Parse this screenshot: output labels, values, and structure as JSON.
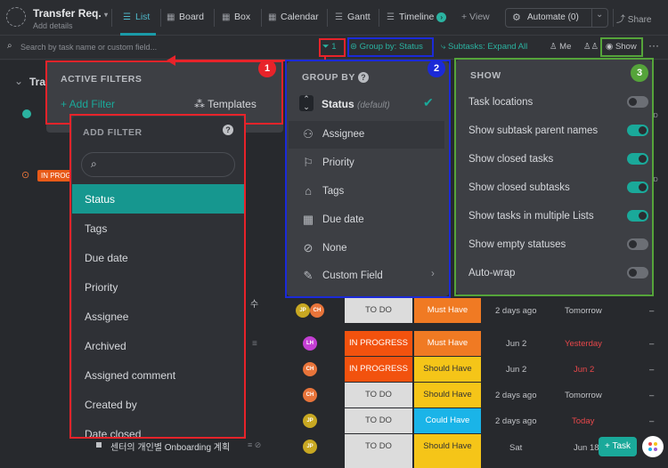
{
  "header": {
    "title": "Transfer Req.",
    "subtitle": "Add details",
    "title_caret": "▾"
  },
  "tabs": [
    {
      "label": "List",
      "icon": "☰"
    },
    {
      "label": "Board",
      "icon": "▦"
    },
    {
      "label": "Box",
      "icon": "▦"
    },
    {
      "label": "Calendar",
      "icon": "▦"
    },
    {
      "label": "Gantt",
      "icon": "☰"
    },
    {
      "label": "Timeline",
      "icon": "☰"
    },
    {
      "label": "+ View",
      "icon": ""
    }
  ],
  "automate": {
    "label": "Automate (0)",
    "caret": "⌄"
  },
  "share": {
    "label": "Share"
  },
  "toolbar": {
    "search_placeholder": "Search by task name or custom field...",
    "filter_count": "1",
    "group_by": "Group by: Status",
    "subtasks": "Subtasks: Expand All",
    "me": "Me",
    "show": "Show",
    "more": "···"
  },
  "markers": [
    "1",
    "2",
    "3"
  ],
  "active_filters": {
    "title": "ACTIVE FILTERS",
    "add_filter": "+ Add Filter",
    "templates": "Templates"
  },
  "add_filter": {
    "title": "ADD FILTER",
    "help": "?",
    "options": [
      "Status",
      "Tags",
      "Due date",
      "Priority",
      "Assignee",
      "Archived",
      "Assigned comment",
      "Created by",
      "Date closed"
    ]
  },
  "group_by": {
    "title": "GROUP BY",
    "help": "?",
    "status_label": "Status",
    "status_note": "(default)",
    "options": [
      "Assignee",
      "Priority",
      "Tags",
      "Due date",
      "None",
      "Custom Field"
    ]
  },
  "show": {
    "title": "SHOW",
    "options": [
      {
        "label": "Task locations",
        "on": false
      },
      {
        "label": "Show subtask parent names",
        "on": true
      },
      {
        "label": "Show closed tasks",
        "on": true
      },
      {
        "label": "Show closed subtasks",
        "on": true
      },
      {
        "label": "Show tasks in multiple Lists",
        "on": true
      },
      {
        "label": "Show empty statuses",
        "on": false
      },
      {
        "label": "Auto-wrap",
        "on": false
      }
    ]
  },
  "background": {
    "list_header": "Tra",
    "in_progress_tag": "IN PROG",
    "korean_char": "수",
    "korean_task": "센터의 개인별 Onboarding 계획",
    "ed_label": "ED",
    "rows": [
      {
        "avatar": "JP",
        "avatar2": "CH",
        "status": "TO DO",
        "priority": "Must Have",
        "start": "2 days ago",
        "due": "Tomorrow",
        "due_red": false,
        "dash": "–"
      },
      {
        "avatar": "LH",
        "status": "IN PROGRESS",
        "priority": "Must Have",
        "start": "Jun 2",
        "due": "Yesterday",
        "due_red": true,
        "dash": "–"
      },
      {
        "avatar": "CH",
        "status": "IN PROGRESS",
        "priority": "Should Have",
        "start": "Jun 2",
        "due": "Jun 2",
        "due_red": true,
        "dash": "–"
      },
      {
        "avatar": "CH",
        "status": "TO DO",
        "priority": "Should Have",
        "start": "2 days ago",
        "due": "Tomorrow",
        "due_red": false,
        "dash": "–"
      },
      {
        "avatar": "JP",
        "status": "TO DO",
        "priority": "Could Have",
        "start": "2 days ago",
        "due": "Today",
        "due_red": true,
        "dash": "–"
      },
      {
        "avatar": "JP",
        "status": "TO DO",
        "priority": "Should Have",
        "start": "Sat",
        "due": "Jun 18",
        "due_red": false,
        "dash": ""
      }
    ],
    "add_task": "+ Task"
  },
  "colors": {
    "accent": "#1a9ba8",
    "red": "#e8232a",
    "blue": "#1b2ad8",
    "green": "#55a43a",
    "teal": "#16978f"
  }
}
